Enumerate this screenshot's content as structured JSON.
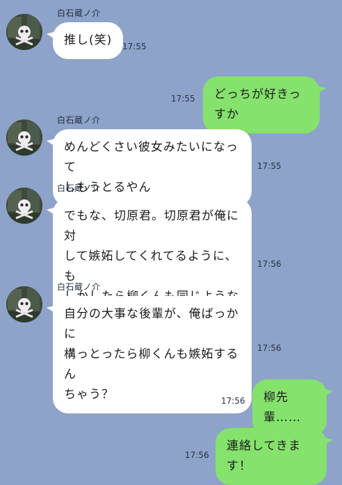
{
  "contact": {
    "name": "白石蔵ノ介",
    "avatar_icon": "skull-crossbones-avatar-icon"
  },
  "colors": {
    "background": "#8da3c9",
    "incoming_bubble": "#ffffff",
    "outgoing_bubble": "#85e26c"
  },
  "messages": [
    {
      "direction": "in",
      "sender": "白石蔵ノ介",
      "text": "推し(笑)",
      "time": "17:55"
    },
    {
      "direction": "out",
      "text": "どっちが好きっすか",
      "time": "17:55"
    },
    {
      "direction": "in",
      "sender": "白石蔵ノ介",
      "text": "めんどくさい彼女みたいになって\nしもうとるやん",
      "time": "17:55"
    },
    {
      "direction": "in",
      "sender": "白石蔵ノ介",
      "text": "でもな、切原君。切原君が俺に対\nして嫉妬してくれてるように、も\nしかしたら柳くんも同じような感\n情抱いとるかもよ",
      "time": "17:56"
    },
    {
      "direction": "in",
      "sender": "白石蔵ノ介",
      "text": "自分の大事な後輩が、俺ばっかに\n構っとったら柳くんも嫉妬するん\nちゃう？",
      "time": "17:56"
    },
    {
      "direction": "out",
      "text": "柳先輩……",
      "time": "17:56"
    },
    {
      "direction": "out",
      "text": "連絡してきます！",
      "time": "17:56"
    }
  ]
}
